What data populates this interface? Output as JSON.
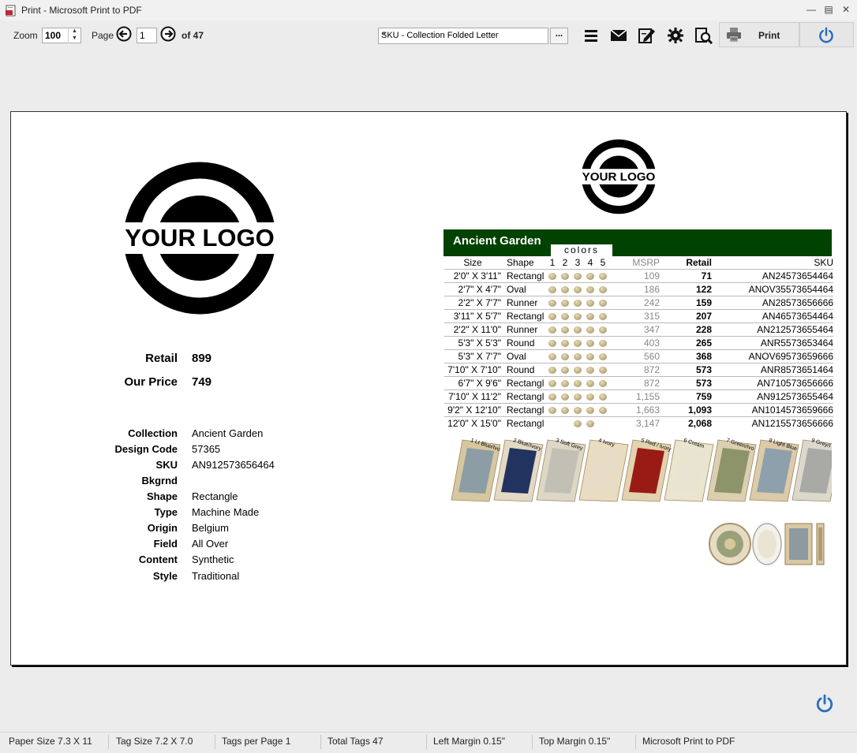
{
  "window": {
    "title": "Print - Microsoft Print to PDF"
  },
  "toolbar": {
    "zoom_label": "Zoom",
    "zoom_value": "100",
    "page_label": "Page",
    "page_value": "1",
    "page_of": "of 47",
    "template_select": "SKU - Collection Folded Letter",
    "more_label": "...",
    "print_label": "Print"
  },
  "tag": {
    "logo_text": "YOUR LOGO",
    "retail_label": "Retail",
    "retail_value": "899",
    "ourprice_label": "Our Price",
    "ourprice_value": "749",
    "specs": [
      {
        "k": "Collection",
        "v": "Ancient Garden"
      },
      {
        "k": "Design Code",
        "v": "57365"
      },
      {
        "k": "SKU",
        "v": "AN912573656464"
      },
      {
        "k": "Bkgrnd",
        "v": ""
      },
      {
        "k": "Shape",
        "v": "Rectangle"
      },
      {
        "k": "Type",
        "v": "Machine Made"
      },
      {
        "k": "Origin",
        "v": "Belgium"
      },
      {
        "k": "Field",
        "v": "All Over"
      },
      {
        "k": "Content",
        "v": "Synthetic"
      },
      {
        "k": "Style",
        "v": "Traditional"
      }
    ],
    "collection_title": "Ancient Garden",
    "colors_label": "colors",
    "headers": {
      "size": "Size",
      "shape": "Shape",
      "c1": "1",
      "c2": "2",
      "c3": "3",
      "c4": "4",
      "c5": "5",
      "msrp": "MSRP",
      "retail": "Retail",
      "sku": "SKU"
    },
    "rows": [
      {
        "size": "2'0\" X 3'11\"",
        "shape": "Rectangl",
        "dots": [
          1,
          1,
          1,
          1,
          1
        ],
        "msrp": "109",
        "retail": "71",
        "sku": "AN24573654464"
      },
      {
        "size": "2'7\" X 4'7\"",
        "shape": "Oval",
        "dots": [
          1,
          1,
          1,
          1,
          1
        ],
        "msrp": "186",
        "retail": "122",
        "sku": "ANOV35573654464"
      },
      {
        "size": "2'2\" X 7'7\"",
        "shape": "Runner",
        "dots": [
          1,
          1,
          1,
          1,
          1
        ],
        "msrp": "242",
        "retail": "159",
        "sku": "AN28573656666"
      },
      {
        "size": "3'11\" X 5'7\"",
        "shape": "Rectangl",
        "dots": [
          1,
          1,
          1,
          1,
          1
        ],
        "msrp": "315",
        "retail": "207",
        "sku": "AN46573654464"
      },
      {
        "size": "2'2\" X 11'0\"",
        "shape": "Runner",
        "dots": [
          1,
          1,
          1,
          1,
          1
        ],
        "msrp": "347",
        "retail": "228",
        "sku": "AN212573655464"
      },
      {
        "size": "5'3\" X 5'3\"",
        "shape": "Round",
        "dots": [
          1,
          1,
          1,
          1,
          1
        ],
        "msrp": "403",
        "retail": "265",
        "sku": "ANR5573653464"
      },
      {
        "size": "5'3\" X 7'7\"",
        "shape": "Oval",
        "dots": [
          1,
          1,
          1,
          1,
          1
        ],
        "msrp": "560",
        "retail": "368",
        "sku": "ANOV69573659666"
      },
      {
        "size": "7'10\" X 7'10\"",
        "shape": "Round",
        "dots": [
          1,
          1,
          1,
          1,
          1
        ],
        "msrp": "872",
        "retail": "573",
        "sku": "ANR8573651464"
      },
      {
        "size": "6'7\" X 9'6\"",
        "shape": "Rectangl",
        "dots": [
          1,
          1,
          1,
          1,
          1
        ],
        "msrp": "872",
        "retail": "573",
        "sku": "AN710573656666"
      },
      {
        "size": "7'10\" X 11'2\"",
        "shape": "Rectangl",
        "dots": [
          1,
          1,
          1,
          1,
          1
        ],
        "msrp": "1,155",
        "retail": "759",
        "sku": "AN912573655464"
      },
      {
        "size": "9'2\" X 12'10\"",
        "shape": "Rectangl",
        "dots": [
          1,
          1,
          1,
          1,
          1
        ],
        "msrp": "1,663",
        "retail": "1,093",
        "sku": "AN1014573659666"
      },
      {
        "size": "12'0\" X 15'0\"",
        "shape": "Rectangl",
        "dots": [
          0,
          0,
          1,
          1,
          0
        ],
        "msrp": "3,147",
        "retail": "2,068",
        "sku": "AN1215573656666"
      }
    ],
    "swatch_labels": [
      "1 Lt Blue/Ivo",
      "2 Blue/Ivory",
      "3 Soft Grey",
      "4 Ivory",
      "5 Red / Ivory",
      "6 Cream",
      "7 Green/Ivo",
      "8 Light Blue",
      "9 Grey/I"
    ]
  },
  "status": {
    "paper_size": "Paper Size 7.3 X 11",
    "tag_size": "Tag Size 7.2 X 7.0",
    "tags_per_page": "Tags per Page 1",
    "total_tags": "Total Tags 47",
    "left_margin": "Left Margin 0.15\"",
    "top_margin": "Top Margin 0.15\"",
    "printer": "Microsoft Print to PDF"
  },
  "colors": {
    "header_green": "#004200",
    "power_blue": "#2a6ebb"
  },
  "icons": [
    "pdf-app-icon",
    "minimize-icon",
    "maximize-icon",
    "close-icon",
    "prev-page-icon",
    "next-page-icon",
    "menu-icon",
    "mail-icon",
    "edit-icon",
    "gear-icon",
    "search-doc-icon",
    "printer-icon",
    "power-icon"
  ]
}
